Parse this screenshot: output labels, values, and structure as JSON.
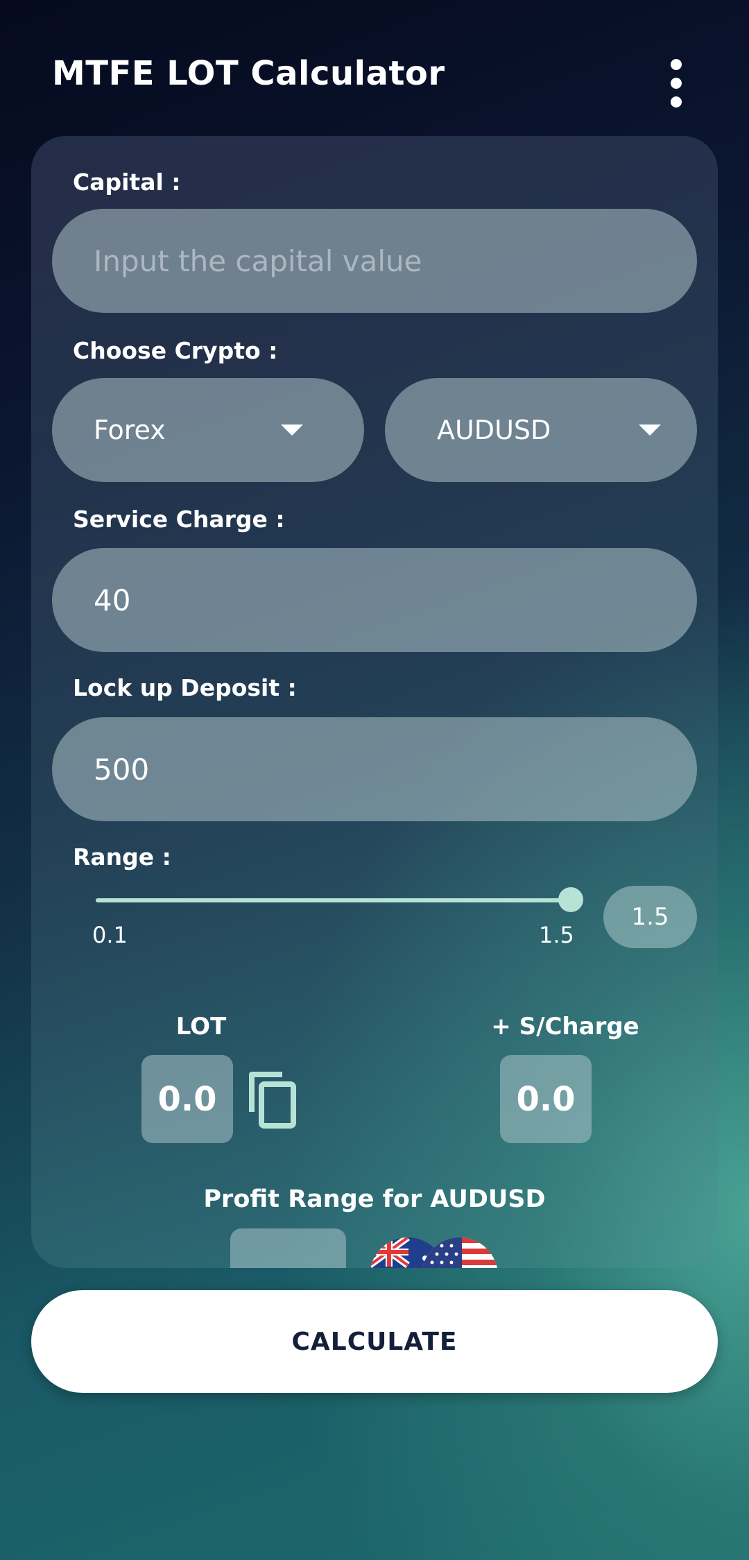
{
  "app": {
    "title": "MTFE LOT Calculator",
    "menu_icon": "more-vertical-icon"
  },
  "form": {
    "capital": {
      "label": "Capital :",
      "placeholder": "Input the capital value",
      "value": ""
    },
    "crypto": {
      "label": "Choose Crypto :",
      "market": "Forex",
      "pair": "AUDUSD"
    },
    "service_charge": {
      "label": "Service Charge :",
      "value": "40"
    },
    "lock_up_deposit": {
      "label": "Lock up Deposit :",
      "value": "500"
    },
    "range": {
      "label": "Range :",
      "min_label": "0.1",
      "max_label": "1.5",
      "value": "1.5",
      "min": 0.1,
      "max": 1.5,
      "current": 1.5
    }
  },
  "results": {
    "lot_label": "LOT",
    "lot_value": "0.0",
    "scharge_label": "+ S/Charge",
    "scharge_value": "0.0",
    "profit_title": "Profit Range for AUDUSD"
  },
  "actions": {
    "calculate": "CALCULATE"
  },
  "colors": {
    "accent": "#b6e3d6",
    "button_text": "#14203a",
    "loss_red": "#e04848"
  }
}
